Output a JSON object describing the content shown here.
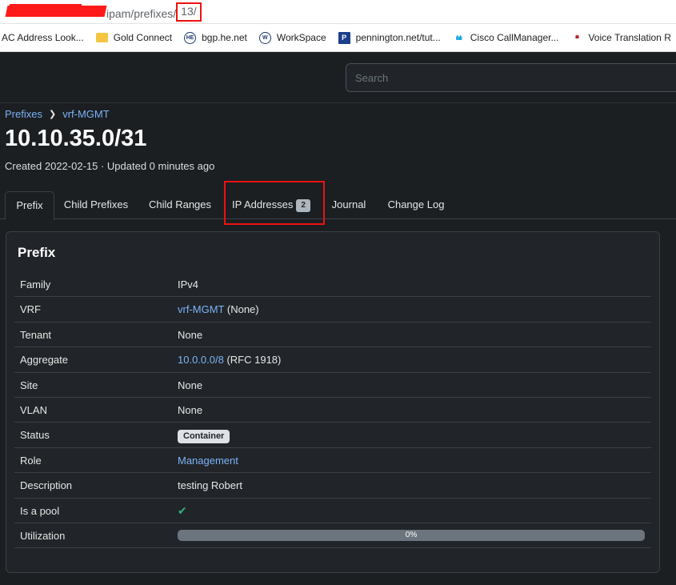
{
  "browser": {
    "url_path": "ipam/prefixes/",
    "url_highlight": "13/",
    "bookmarks": [
      {
        "label": "AC Address Look...",
        "icon": "none"
      },
      {
        "label": "Gold Connect",
        "icon": "folder-icon"
      },
      {
        "label": "bgp.he.net",
        "icon": "he-logo-icon"
      },
      {
        "label": "WorkSpace",
        "icon": "workspace-logo-icon"
      },
      {
        "label": "pennington.net/tut...",
        "icon": "p-logo-icon"
      },
      {
        "label": "Cisco CallManager...",
        "icon": "cisco-icon"
      },
      {
        "label": "Voice Translation R",
        "icon": "cisco-red-icon"
      }
    ]
  },
  "search": {
    "placeholder": "Search"
  },
  "breadcrumb": {
    "root": "Prefixes",
    "current": "vrf-MGMT"
  },
  "page": {
    "title": "10.10.35.0/31",
    "meta": "Created 2022-02-15 · Updated 0 minutes ago"
  },
  "tabs": [
    {
      "label": "Prefix",
      "active": true
    },
    {
      "label": "Child Prefixes"
    },
    {
      "label": "Child Ranges"
    },
    {
      "label": "IP Addresses",
      "count": "2"
    },
    {
      "label": "Journal"
    },
    {
      "label": "Change Log"
    }
  ],
  "card": {
    "title": "Prefix",
    "rows": {
      "family": {
        "label": "Family",
        "value": "IPv4"
      },
      "vrf": {
        "label": "VRF",
        "link": "vrf-MGMT",
        "suffix": "(None)"
      },
      "tenant": {
        "label": "Tenant",
        "value": "None"
      },
      "aggregate": {
        "label": "Aggregate",
        "link": "10.0.0.0/8",
        "suffix": "(RFC 1918)"
      },
      "site": {
        "label": "Site",
        "value": "None"
      },
      "vlan": {
        "label": "VLAN",
        "value": "None"
      },
      "status": {
        "label": "Status",
        "badge": "Container"
      },
      "role": {
        "label": "Role",
        "link": "Management"
      },
      "description": {
        "label": "Description",
        "value": "testing Robert"
      },
      "pool": {
        "label": "Is a pool",
        "icon": "check-icon",
        "value": "✔"
      },
      "utilization": {
        "label": "Utilization",
        "value": "0%",
        "percent": 0
      }
    }
  },
  "colors": {
    "accent": "#7bb2f6",
    "highlight": "#ee1111",
    "success": "#2fb380"
  }
}
